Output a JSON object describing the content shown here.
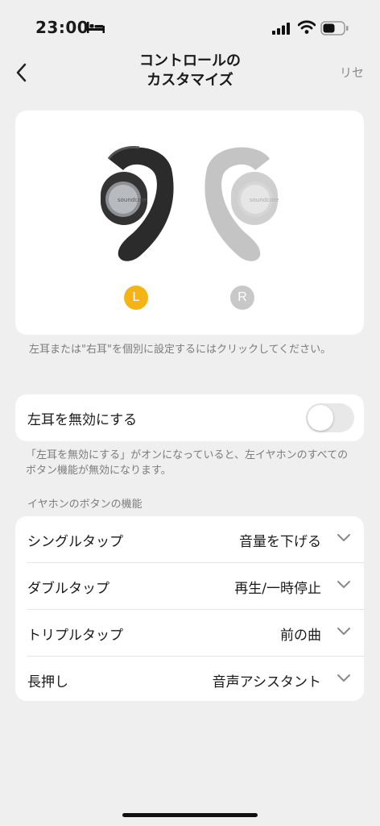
{
  "status_bar": {
    "time": "23:00"
  },
  "nav": {
    "title_line1": "コントロールの",
    "title_line2": "カスタマイズ",
    "reset_label": "リセ"
  },
  "earbuds": {
    "left_badge": "L",
    "right_badge": "R",
    "selected": "L",
    "selected_color": "#f5b415",
    "unselected_color": "#c8c8c8"
  },
  "hint_top": "左耳または\"右耳\"を個別に設定するにはクリックしてください。",
  "disable_left": {
    "label": "左耳を無効にする",
    "enabled": false,
    "toggle_off_color": "#e8e8e8"
  },
  "hint_mid": "「左耳を無効にする」がオンになっていると、左イヤホンのすべてのボタン機能が無効になります。",
  "controls_section": {
    "header": "イヤホンのボタンの機能",
    "rows": [
      {
        "label": "シングルタップ",
        "value": "音量を下げる"
      },
      {
        "label": "ダブルタップ",
        "value": "再生/一時停止"
      },
      {
        "label": "トリプルタップ",
        "value": "前の曲"
      },
      {
        "label": "長押し",
        "value": "音声アシスタント"
      }
    ]
  }
}
